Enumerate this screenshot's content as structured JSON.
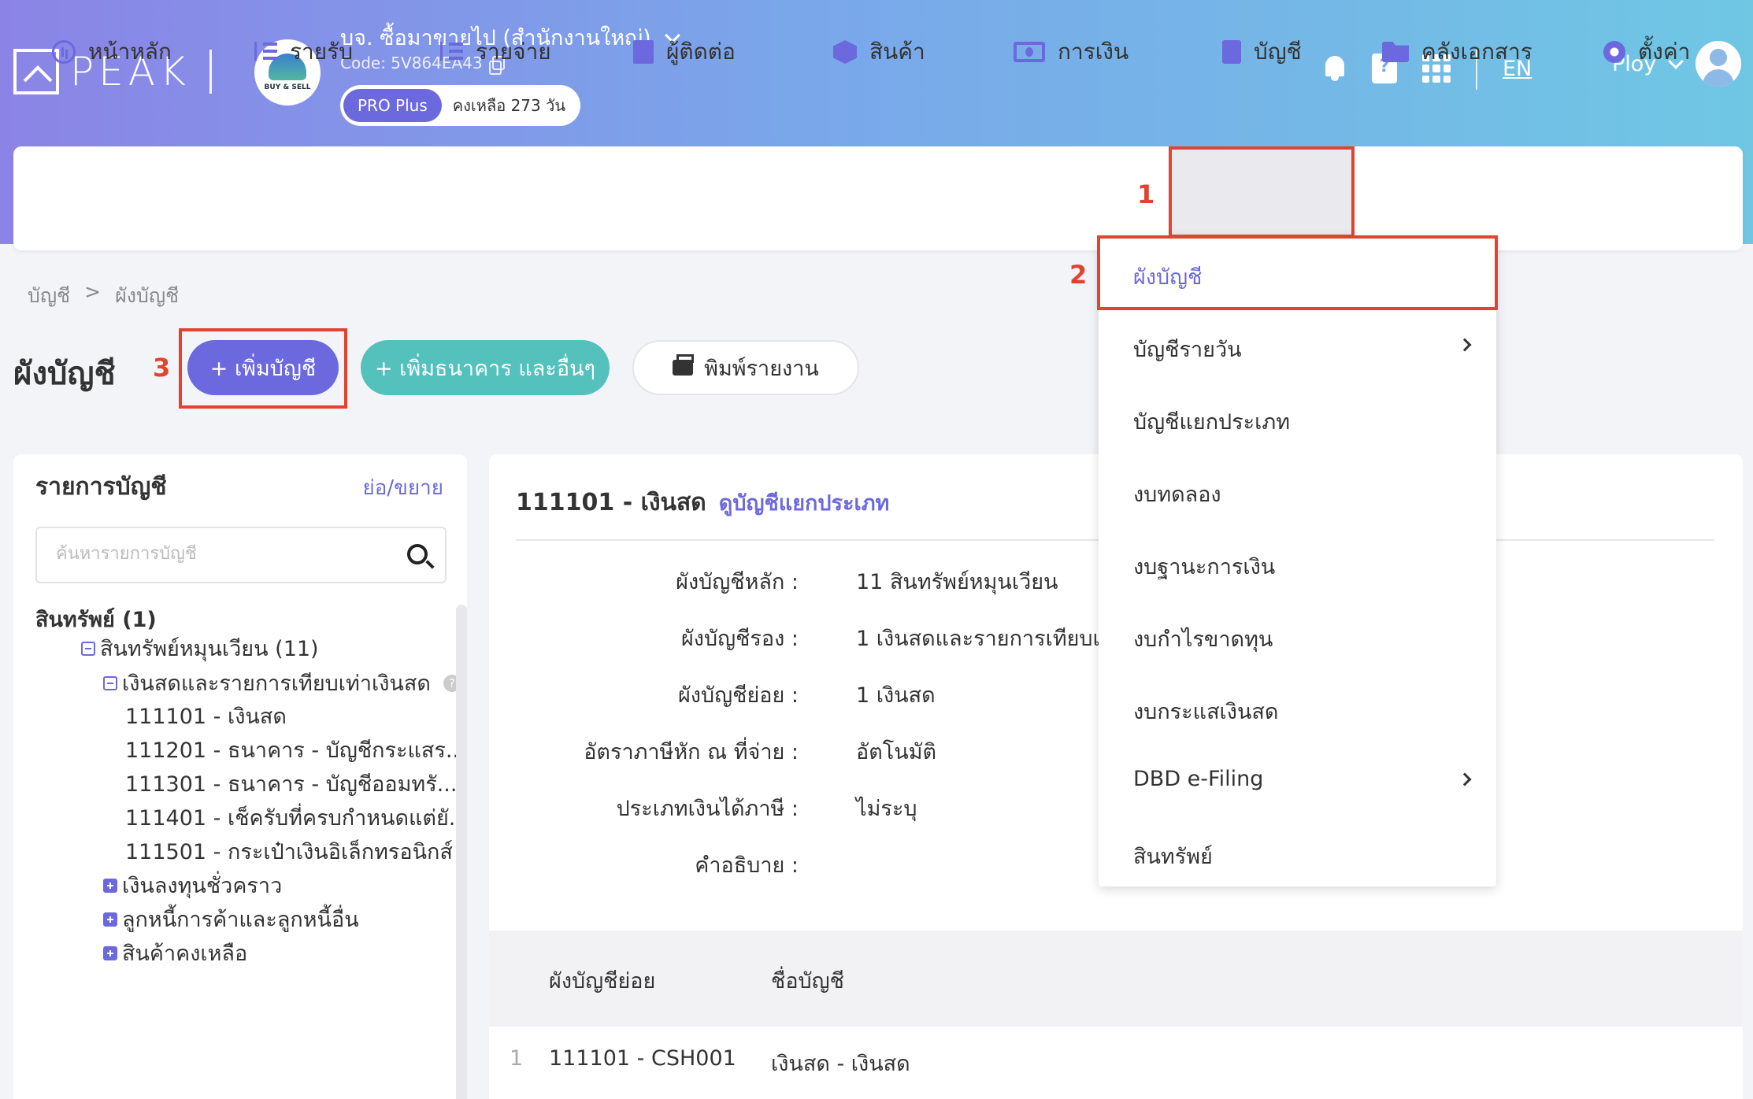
{
  "header": {
    "logo_text": "PEAK",
    "company_name": "บจ. ซื้อมาขายไป (สำนักงานใหญ่)",
    "company_logo_caption": "BUY & SELL",
    "company_code": "Code: 5V864EA43",
    "plan_badge": "PRO Plus",
    "plan_remaining": "คงเหลือ 273 วัน",
    "help_glyph": "?",
    "language": "EN",
    "user_name": "Ploy",
    "icons": [
      "bell-icon",
      "help-book-icon",
      "apps-grid-icon",
      "copy-icon",
      "user-avatar-icon"
    ]
  },
  "nav": {
    "items": [
      {
        "label": "หน้าหลัก",
        "icon": "dashboard-icon"
      },
      {
        "label": "รายรับ",
        "icon": "income-list-icon"
      },
      {
        "label": "รายจ่าย",
        "icon": "expense-list-icon"
      },
      {
        "label": "ผู้ติดต่อ",
        "icon": "contacts-icon"
      },
      {
        "label": "สินค้า",
        "icon": "product-box-icon"
      },
      {
        "label": "การเงิน",
        "icon": "finance-cash-icon"
      },
      {
        "label": "บัญชี",
        "icon": "ledger-icon"
      },
      {
        "label": "คลังเอกสาร",
        "icon": "folder-icon"
      },
      {
        "label": "ตั้งค่า",
        "icon": "gear-icon"
      }
    ],
    "active": "บัญชี"
  },
  "annotations": {
    "step1": "1",
    "step2": "2",
    "step3": "3"
  },
  "breadcrumb": {
    "root": "บัญชี",
    "sep": ">",
    "current": "ผังบัญชี"
  },
  "page": {
    "title": "ผังบัญชี",
    "add_account_label": "+ เพิ่มบัญชี",
    "add_bank_label": "+ เพิ่มธนาคาร และอื่นๆ",
    "print_label": "พิมพ์รายงาน"
  },
  "left_panel": {
    "title": "รายการบัญชี",
    "toggle_label": "ย่อ/ขยาย",
    "search_placeholder": "ค้นหารายการบัญชี",
    "tree": [
      {
        "label": "สินทรัพย์ (1)"
      },
      {
        "label": "สินทรัพย์หมุนเวียน (11)"
      },
      {
        "label": "เงินสดและรายการเทียบเท่าเงินสด"
      },
      {
        "label": "111101 - เงินสด"
      },
      {
        "label": "111201 - ธนาคาร - บัญชีกระแสร..."
      },
      {
        "label": "111301 - ธนาคาร - บัญชีออมทรั..."
      },
      {
        "label": "111401 - เช็ครับที่ครบกำหนดแต่ยั..."
      },
      {
        "label": "111501 - กระเป๋าเงินอิเล็กทรอนิกส์"
      },
      {
        "label": "เงินลงทุนชั่วคราว"
      },
      {
        "label": "ลูกหนี้การค้าและลูกหนี้อื่น"
      },
      {
        "label": "สินค้าคงเหลือ"
      }
    ]
  },
  "detail": {
    "heading": "111101 - เงินสด",
    "ledger_link": "ดูบัญชีแยกประเภท",
    "fields": [
      {
        "label": "ผังบัญชีหลัก :",
        "value": "11 สินทรัพย์หมุนเวียน"
      },
      {
        "label": "ผังบัญชีรอง :",
        "value": "1 เงินสดและรายการเทียบเท่"
      },
      {
        "label": "ผังบัญชีย่อย :",
        "value": "1 เงินสด"
      },
      {
        "label": "อัตราภาษีหัก ณ ที่จ่าย :",
        "value": "อัตโนมัติ"
      },
      {
        "label": "ประเภทเงินได้ภาษี :",
        "value": "ไม่ระบุ"
      },
      {
        "label": "คำอธิบาย :",
        "value": ""
      }
    ],
    "table": {
      "headers": [
        "ผังบัญชีย่อย",
        "ชื่อบัญชี"
      ],
      "rows": [
        {
          "index": "1",
          "code": "111101 - CSH001",
          "name": "เงินสด - เงินสด"
        }
      ]
    }
  },
  "dropdown": {
    "items": [
      {
        "label": "ผังบัญชี",
        "active": true
      },
      {
        "label": "บัญชีรายวัน",
        "submenu": true
      },
      {
        "label": "บัญชีแยกประเภท"
      },
      {
        "label": "งบทดลอง"
      },
      {
        "label": "งบฐานะการเงิน"
      },
      {
        "label": "งบกำไรขาดทุน"
      },
      {
        "label": "งบกระแสเงินสด"
      },
      {
        "label": "DBD e-Filing",
        "submenu": true
      },
      {
        "label": "สินทรัพย์"
      }
    ]
  },
  "colors": {
    "accent": "#6c69de",
    "teal": "#54c1bd",
    "annotation": "#e0442e"
  }
}
